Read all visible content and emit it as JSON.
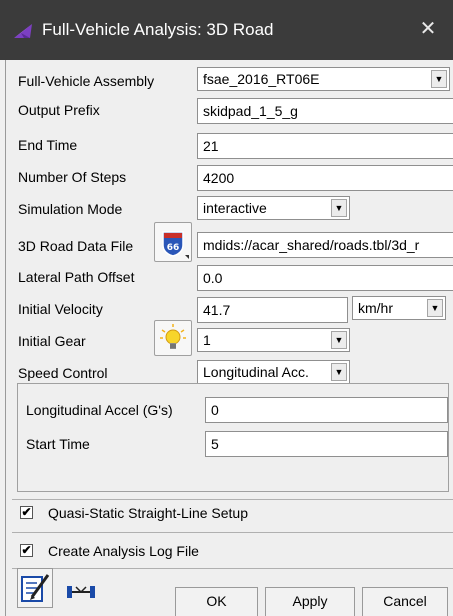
{
  "window": {
    "title": "Full-Vehicle Analysis: 3D Road",
    "close_glyph": "✕",
    "app_icon": "adams-car-icon"
  },
  "form": {
    "assembly": {
      "label": "Full-Vehicle Assembly",
      "value": "fsae_2016_RT06E"
    },
    "output_prefix": {
      "label": "Output Prefix",
      "value": "skidpad_1_5_g"
    },
    "end_time": {
      "label": "End Time",
      "value": "21"
    },
    "number_of_steps": {
      "label": "Number Of Steps",
      "value": "4200"
    },
    "simulation_mode": {
      "label": "Simulation Mode",
      "value": "interactive"
    },
    "road_data_file": {
      "label": "3D Road Data File",
      "value": "mdids://acar_shared/roads.tbl/3d_r",
      "icon": "road-file-browse-icon",
      "icon_text": "66"
    },
    "lateral_path_offset": {
      "label": "Lateral Path Offset",
      "value": "0.0"
    },
    "initial_velocity": {
      "label": "Initial Velocity",
      "value": "41.7",
      "unit": "km/hr"
    },
    "initial_gear": {
      "label": "Initial Gear",
      "value": "1",
      "icon": "lightbulb-icon"
    },
    "speed_control": {
      "label": "Speed Control",
      "value": "Longitudinal Acc."
    }
  },
  "speed_group": {
    "longitudinal_accel": {
      "label": "Longitudinal Accel (G's)",
      "value": "0"
    },
    "start_time": {
      "label": "Start Time",
      "value": "5"
    }
  },
  "options": {
    "quasi_static": {
      "label": "Quasi-Static Straight-Line Setup",
      "checked": true,
      "mark": "✔"
    },
    "create_log": {
      "label": "Create Analysis Log File",
      "checked": true,
      "mark": "✔"
    }
  },
  "buttons": {
    "ok": "OK",
    "apply": "Apply",
    "cancel": "Cancel"
  },
  "toolbar": {
    "edit_icon": "edit-form-icon",
    "vehicle_icon": "vehicle-icon"
  },
  "colors": {
    "titlebar": "#3b3b3b",
    "dialog_bg": "#f0f0f0",
    "highway_shield": "#2a56b8",
    "bulb": "#f7d52a"
  }
}
